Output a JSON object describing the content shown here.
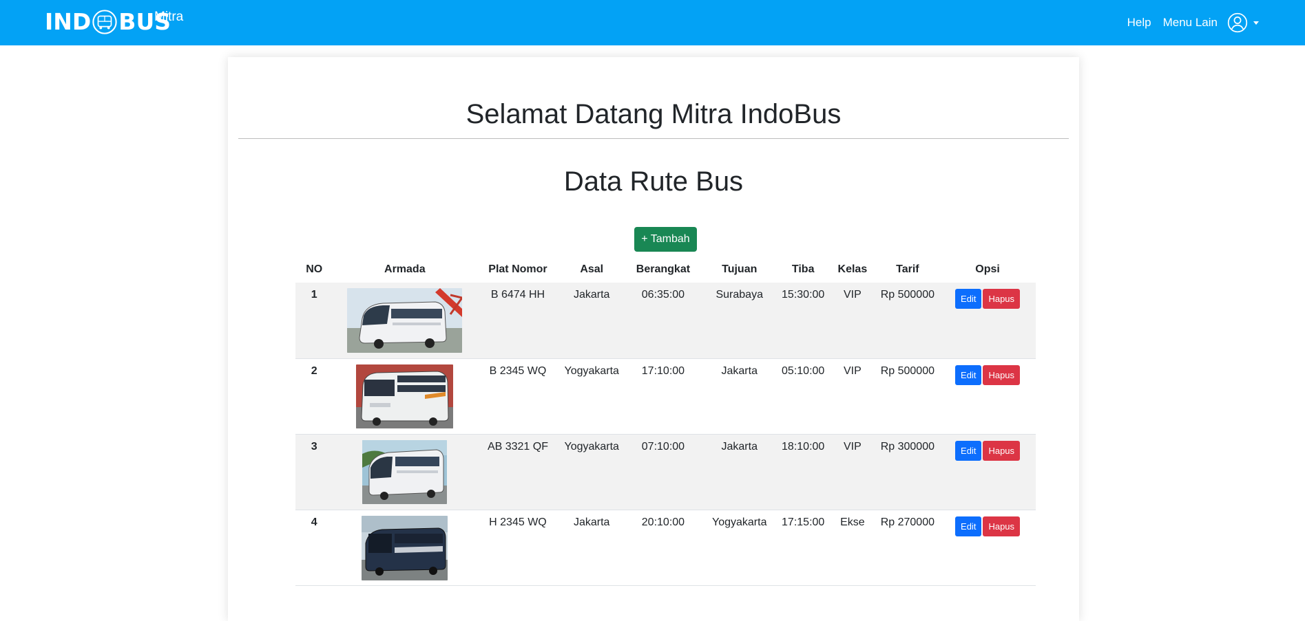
{
  "navbar": {
    "brand_left": "IND",
    "brand_right": "BUS",
    "brand_sub": "Mitra",
    "links": [
      "Help",
      "Menu Lain"
    ],
    "colors": {
      "bar": "#03a2f5",
      "text": "#ffffff"
    },
    "icons": {
      "logo": "bus-logo-icon",
      "user": "user-circle-icon",
      "dropdown": "caret-down-icon"
    }
  },
  "main": {
    "welcome": "Selamat Datang Mitra IndoBus",
    "section_title": "Data Rute Bus",
    "add_button": "+ Tambah"
  },
  "table": {
    "headers": [
      "NO",
      "Armada",
      "Plat Nomor",
      "Asal",
      "Berangkat",
      "Tujuan",
      "Tiba",
      "Kelas",
      "Tarif",
      "Opsi"
    ],
    "edit_label": "Edit",
    "delete_label": "Hapus",
    "rows": [
      {
        "no": "1",
        "armada": "bus-photo-1",
        "plat": "B 6474 HH",
        "asal": "Jakarta",
        "berangkat": "06:35:00",
        "tujuan": "Surabaya",
        "tiba": "15:30:00",
        "kelas": "VIP",
        "tarif": "Rp 500000"
      },
      {
        "no": "2",
        "armada": "bus-photo-2",
        "plat": "B 2345 WQ",
        "asal": "Yogyakarta",
        "berangkat": "17:10:00",
        "tujuan": "Jakarta",
        "tiba": "05:10:00",
        "kelas": "VIP",
        "tarif": "Rp 500000"
      },
      {
        "no": "3",
        "armada": "bus-photo-3",
        "plat": "AB 3321 QF",
        "asal": "Yogyakarta",
        "berangkat": "07:10:00",
        "tujuan": "Jakarta",
        "tiba": "18:10:00",
        "kelas": "VIP",
        "tarif": "Rp 300000"
      },
      {
        "no": "4",
        "armada": "bus-photo-4",
        "plat": "H 2345 WQ",
        "asal": "Jakarta",
        "berangkat": "20:10:00",
        "tujuan": "Yogyakarta",
        "tiba": "17:15:00",
        "kelas": "Ekse",
        "tarif": "Rp 270000"
      }
    ]
  },
  "colors": {
    "add_button": "#198754",
    "edit_button": "#0d6efd",
    "delete_button": "#dc3545",
    "row_stripe": "#f2f2f2"
  }
}
